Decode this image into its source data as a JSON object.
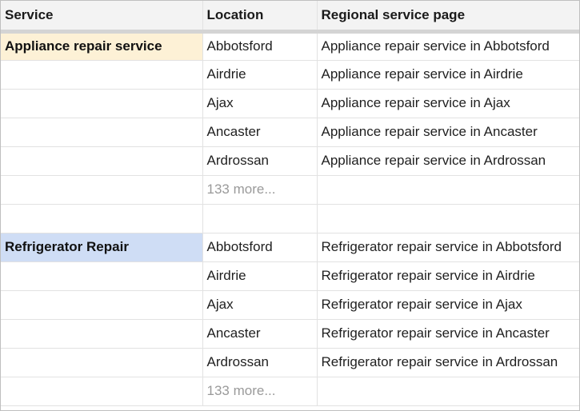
{
  "headers": {
    "service": "Service",
    "location": "Location",
    "page": "Regional service page"
  },
  "groups": [
    {
      "service": "Appliance repair service",
      "color": "#fdf1d6",
      "rows": [
        {
          "location": "Abbotsford",
          "page": "Appliance repair service in Abbotsford"
        },
        {
          "location": "Airdrie",
          "page": "Appliance repair service in Airdrie"
        },
        {
          "location": "Ajax",
          "page": "Appliance repair service in Ajax"
        },
        {
          "location": "Ancaster",
          "page": "Appliance repair service in Ancaster"
        },
        {
          "location": "Ardrossan",
          "page": "Appliance repair service in Ardrossan"
        }
      ],
      "more": "133 more..."
    },
    {
      "service": "Refrigerator Repair",
      "color": "#cfddf5",
      "rows": [
        {
          "location": "Abbotsford",
          "page": "Refrigerator repair service in Abbotsford"
        },
        {
          "location": "Airdrie",
          "page": "Refrigerator repair service in Airdrie"
        },
        {
          "location": "Ajax",
          "page": "Refrigerator repair service in Ajax"
        },
        {
          "location": "Ancaster",
          "page": "Refrigerator repair service in Ancaster"
        },
        {
          "location": "Ardrossan",
          "page": "Refrigerator repair service in Ardrossan"
        }
      ],
      "more": "133 more..."
    }
  ]
}
